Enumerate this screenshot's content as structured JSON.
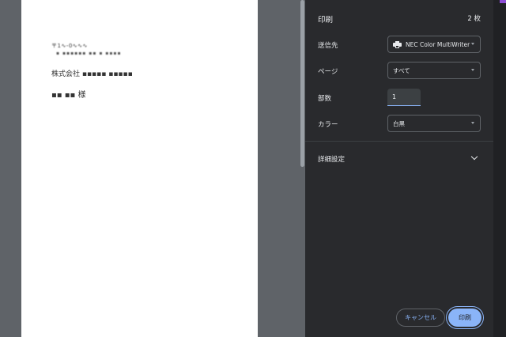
{
  "preview": {
    "postal": "〒1∿-0∿∿∿",
    "street": "▪ ▪▪▪▪▪▪ ▪▪ ▪ ▪▪▪▪",
    "company": "株式会社 ▪▪▪▪▪ ▪▪▪▪▪",
    "name": "▪▪ ▪▪ 様"
  },
  "panel": {
    "title": "印刷",
    "sheet_count": "2 枚",
    "destination": {
      "label": "送信先",
      "value": "NEC Color MultiWriter"
    },
    "pages": {
      "label": "ページ",
      "value": "すべて"
    },
    "copies": {
      "label": "部数",
      "value": "1"
    },
    "color": {
      "label": "カラー",
      "value": "白黒"
    },
    "more_settings": "詳細設定",
    "cancel": "キャンセル",
    "print": "印刷"
  }
}
